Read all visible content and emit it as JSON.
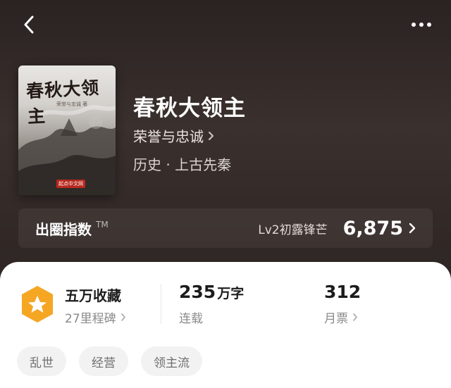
{
  "header": {
    "back_icon": "chevron-left-icon",
    "more_icon": "more-dots-icon"
  },
  "book": {
    "cover": {
      "title": "春秋大领主",
      "author_line": "荣誉与忠诚 著",
      "logo": "起点中文网"
    },
    "title": "春秋大领主",
    "author": "荣誉与忠诚",
    "genre": "历史 · 上古先秦"
  },
  "popularity": {
    "label": "出圈指数",
    "trademark": "TM",
    "level": "Lv2初露锋芒",
    "value": "6,875"
  },
  "stats": {
    "collection": {
      "title": "五万收藏",
      "sub": "27里程碑",
      "icon": "star-badge-icon"
    },
    "words": {
      "number": "235",
      "unit": "万字",
      "status": "连载"
    },
    "monthly_tickets": {
      "number": "312",
      "label": "月票"
    }
  },
  "tags": [
    "乱世",
    "经营",
    "领主流"
  ],
  "colors": {
    "header_bg": "#2e2624",
    "badge_orange": "#f5a623",
    "card_bg": "#ffffff",
    "tag_bg": "#f2f2f2"
  }
}
